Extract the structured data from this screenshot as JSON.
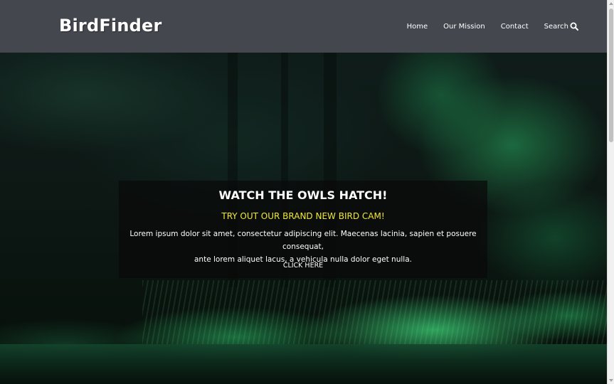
{
  "header": {
    "brand": "BirdFinder",
    "nav": [
      {
        "label": "Home"
      },
      {
        "label": "Our Mission"
      },
      {
        "label": "Contact"
      },
      {
        "label": "Search",
        "icon": "search-icon"
      }
    ]
  },
  "hero": {
    "card": {
      "title": "WATCH THE OWLS HATCH!",
      "subtitle": "TRY OUT OUR BRAND NEW BIRD CAM!",
      "body_line1": "Lorem ipsum dolor sit amet, consectetur adipiscing elit. Maecenas lacinia, sapien et posuere consequat,",
      "body_line2": "ante lorem aliquet lacus, a vehicula nulla dolor eget nulla.",
      "cta": "CLICK HERE"
    }
  },
  "colors": {
    "header_bg": "#45474f",
    "accent_yellow": "#f0e832",
    "text": "#ffffff"
  }
}
